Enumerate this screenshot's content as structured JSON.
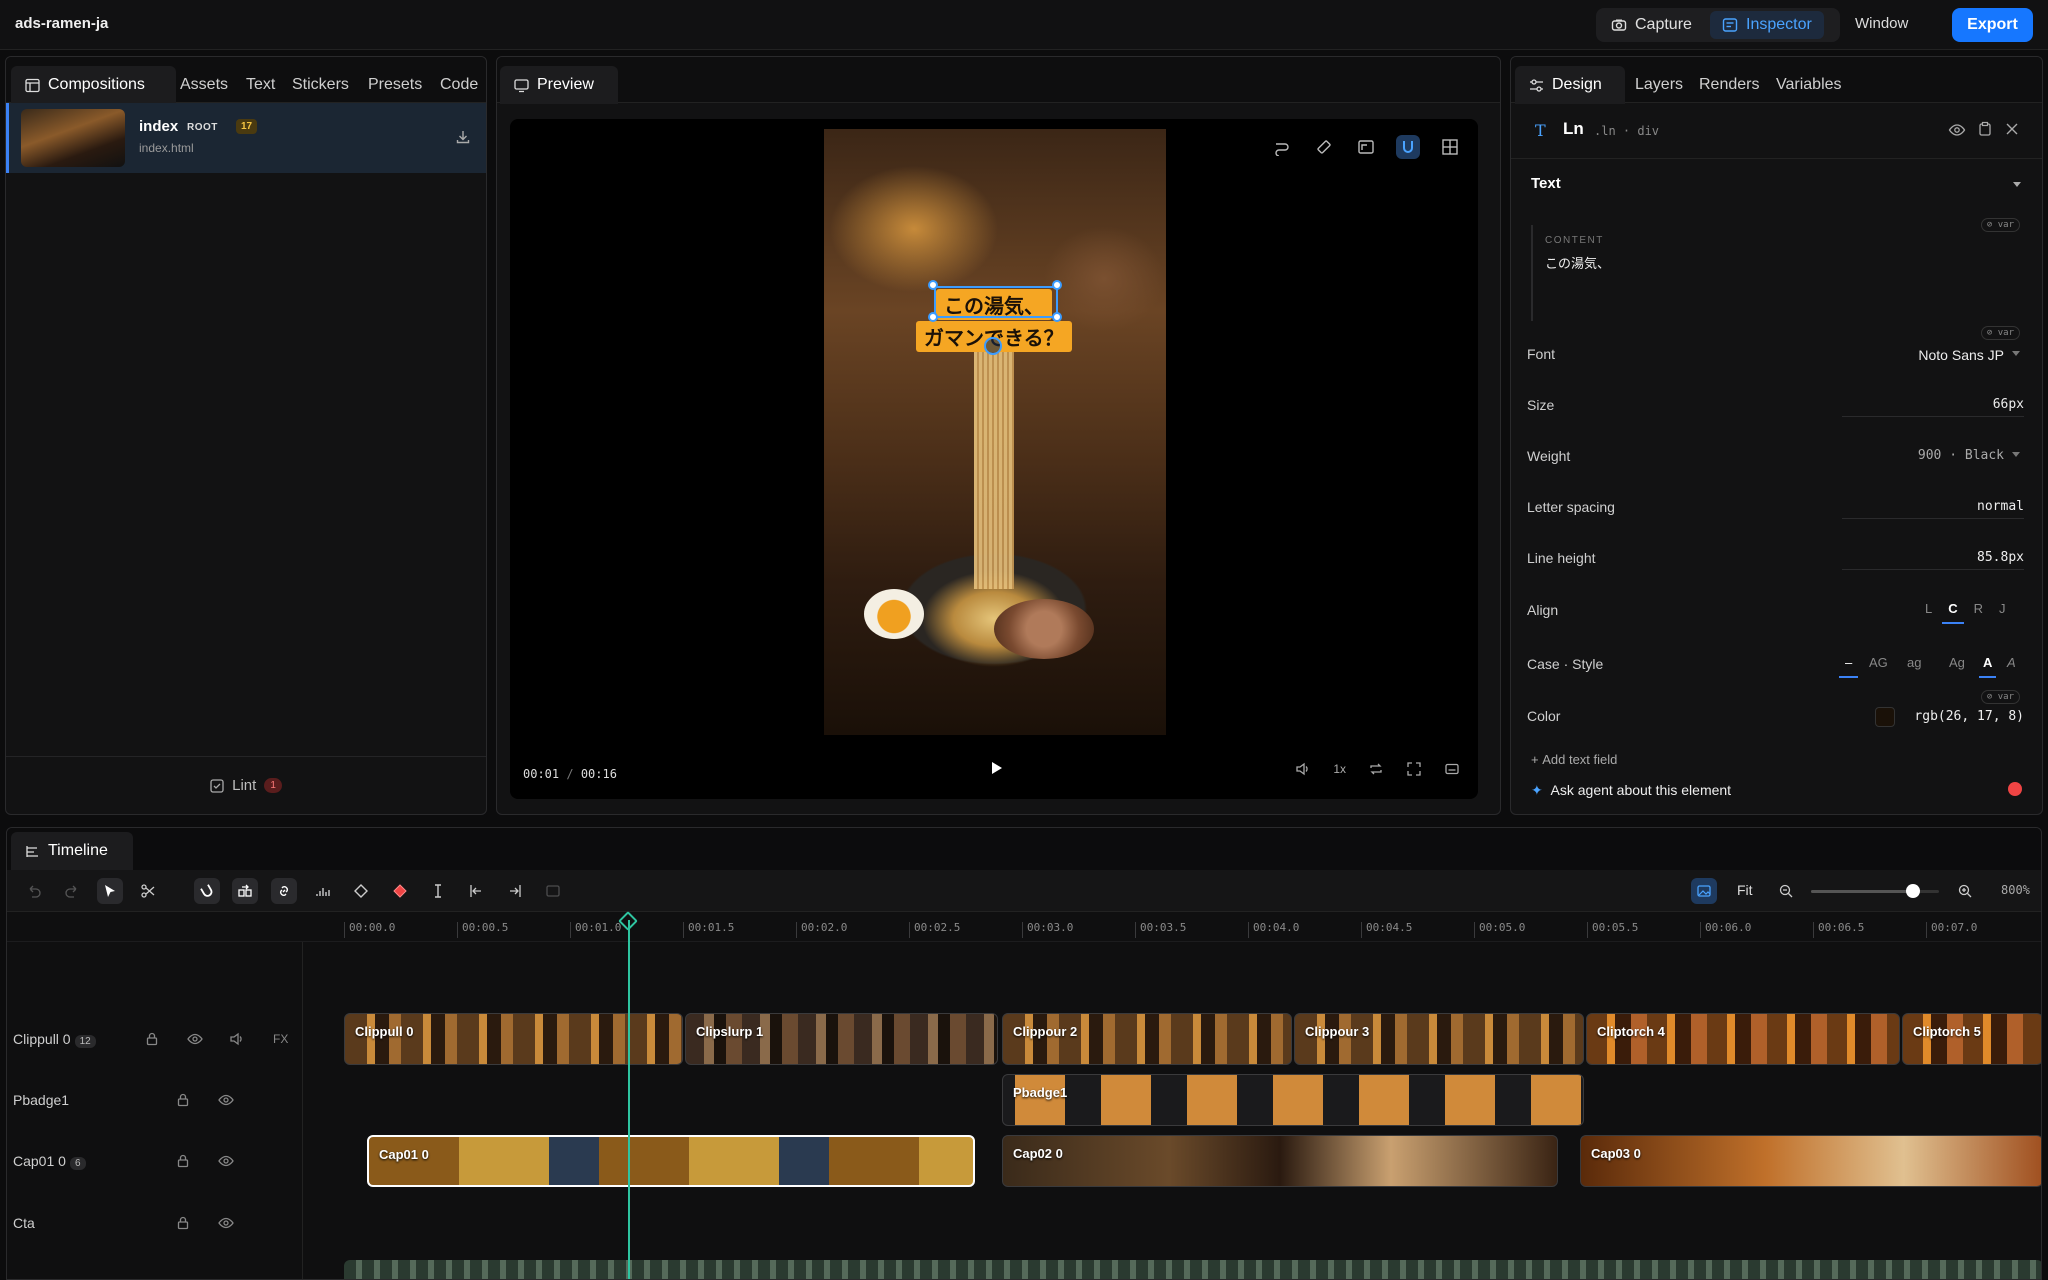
{
  "app": {
    "title": "ads-ramen-ja"
  },
  "topbar": {
    "capture": "Capture",
    "inspector": "Inspector",
    "window": "Window",
    "export": "Export"
  },
  "left": {
    "tabs": [
      "Compositions",
      "Assets",
      "Text",
      "Stickers",
      "Presets",
      "Code"
    ],
    "composition": {
      "name": "index",
      "tag": "ROOT",
      "count": "17",
      "file": "index.html"
    },
    "lint": {
      "label": "Lint",
      "count": "1"
    }
  },
  "preview": {
    "tab": "Preview",
    "caption_line1": "この湯気、",
    "caption_line2": "ガマンできる？",
    "time_current": "00:01",
    "time_sep": "/",
    "time_total": "00:16",
    "speed": "1x"
  },
  "inspector": {
    "tabs": [
      "Design",
      "Layers",
      "Renders",
      "Variables"
    ],
    "element": {
      "name": "Ln",
      "selector": ".ln · div"
    },
    "section": "Text",
    "content_label": "CONTENT",
    "content_value": "この湯気、",
    "var_chip": "⊘ var",
    "props": [
      {
        "label": "Font",
        "value": "Noto Sans JP"
      },
      {
        "label": "Size",
        "value": "66px"
      },
      {
        "label": "Weight",
        "value": "900 · Black"
      },
      {
        "label": "Letter spacing",
        "value": "normal"
      },
      {
        "label": "Line height",
        "value": "85.8px"
      }
    ],
    "align": {
      "label": "Align",
      "options": [
        "L",
        "C",
        "R",
        "J"
      ],
      "selected": "C"
    },
    "case_style": {
      "label": "Case · Style",
      "options": [
        "–",
        "AG",
        "ag",
        "Ag",
        "A",
        "A"
      ]
    },
    "color": {
      "label": "Color",
      "value": "rgb(26, 17, 8)",
      "swatch": "#1a1108"
    },
    "add_text_field": "Add text field",
    "ask_agent": "Ask agent about this element"
  },
  "timeline": {
    "tab": "Timeline",
    "fit": "Fit",
    "zoom": "800%",
    "zoom_level": 0.8,
    "ruler": [
      "00:00.0",
      "00:00.5",
      "00:01.0",
      "00:01.5",
      "00:02.0",
      "00:02.5",
      "00:03.0",
      "00:03.5",
      "00:04.0",
      "00:04.5",
      "00:05.0",
      "00:05.5",
      "00:06.0",
      "00:06.5",
      "00:07.0"
    ],
    "tracks": [
      {
        "label": "Clippull 0",
        "count": "12",
        "fx": "FX"
      },
      {
        "label": "Pbadge1",
        "count": ""
      },
      {
        "label": "Cap01 0",
        "count": "6"
      },
      {
        "label": "Cta",
        "count": ""
      }
    ],
    "clips_video": [
      "Clippull 0",
      "Clipslurp 1",
      "Clippour 2",
      "Clippour 3",
      "Cliptorch 4",
      "Cliptorch 5"
    ],
    "clip_badge": "Pbadge1",
    "clips_caption": [
      "Cap01 0",
      "Cap02 0",
      "Cap03 0"
    ]
  },
  "colors": {
    "accent": "#1677ff",
    "playhead": "#2ec4a0",
    "caption_bg": "#f5a623"
  }
}
